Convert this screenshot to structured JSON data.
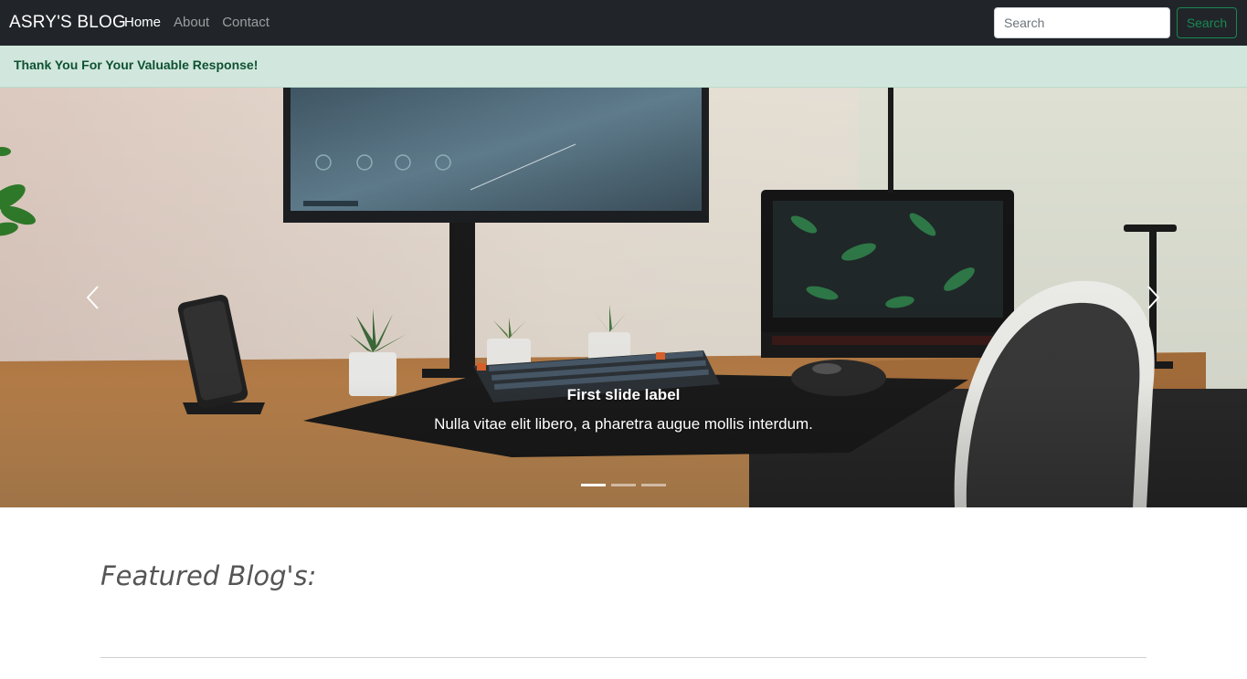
{
  "navbar": {
    "brand": "ASRY'S BLOG",
    "links": [
      "Home",
      "About",
      "Contact"
    ],
    "active_link": "Home",
    "search": {
      "placeholder": "Search",
      "value": "",
      "button_label": "Search"
    }
  },
  "alert": {
    "message": "Thank You For Your Valuable Response!"
  },
  "carousel": {
    "caption_title": "First slide label",
    "caption_text": "Nulla vitae elit libero, a pharetra augue mollis interdum.",
    "slide_count": 3,
    "active_slide": 1
  },
  "featured": {
    "heading": "Featured Blog's:"
  },
  "colors": {
    "navbar": "#212529",
    "alert_bg": "#d1e7dd",
    "alert_text": "#0f5132",
    "success": "#198754"
  }
}
